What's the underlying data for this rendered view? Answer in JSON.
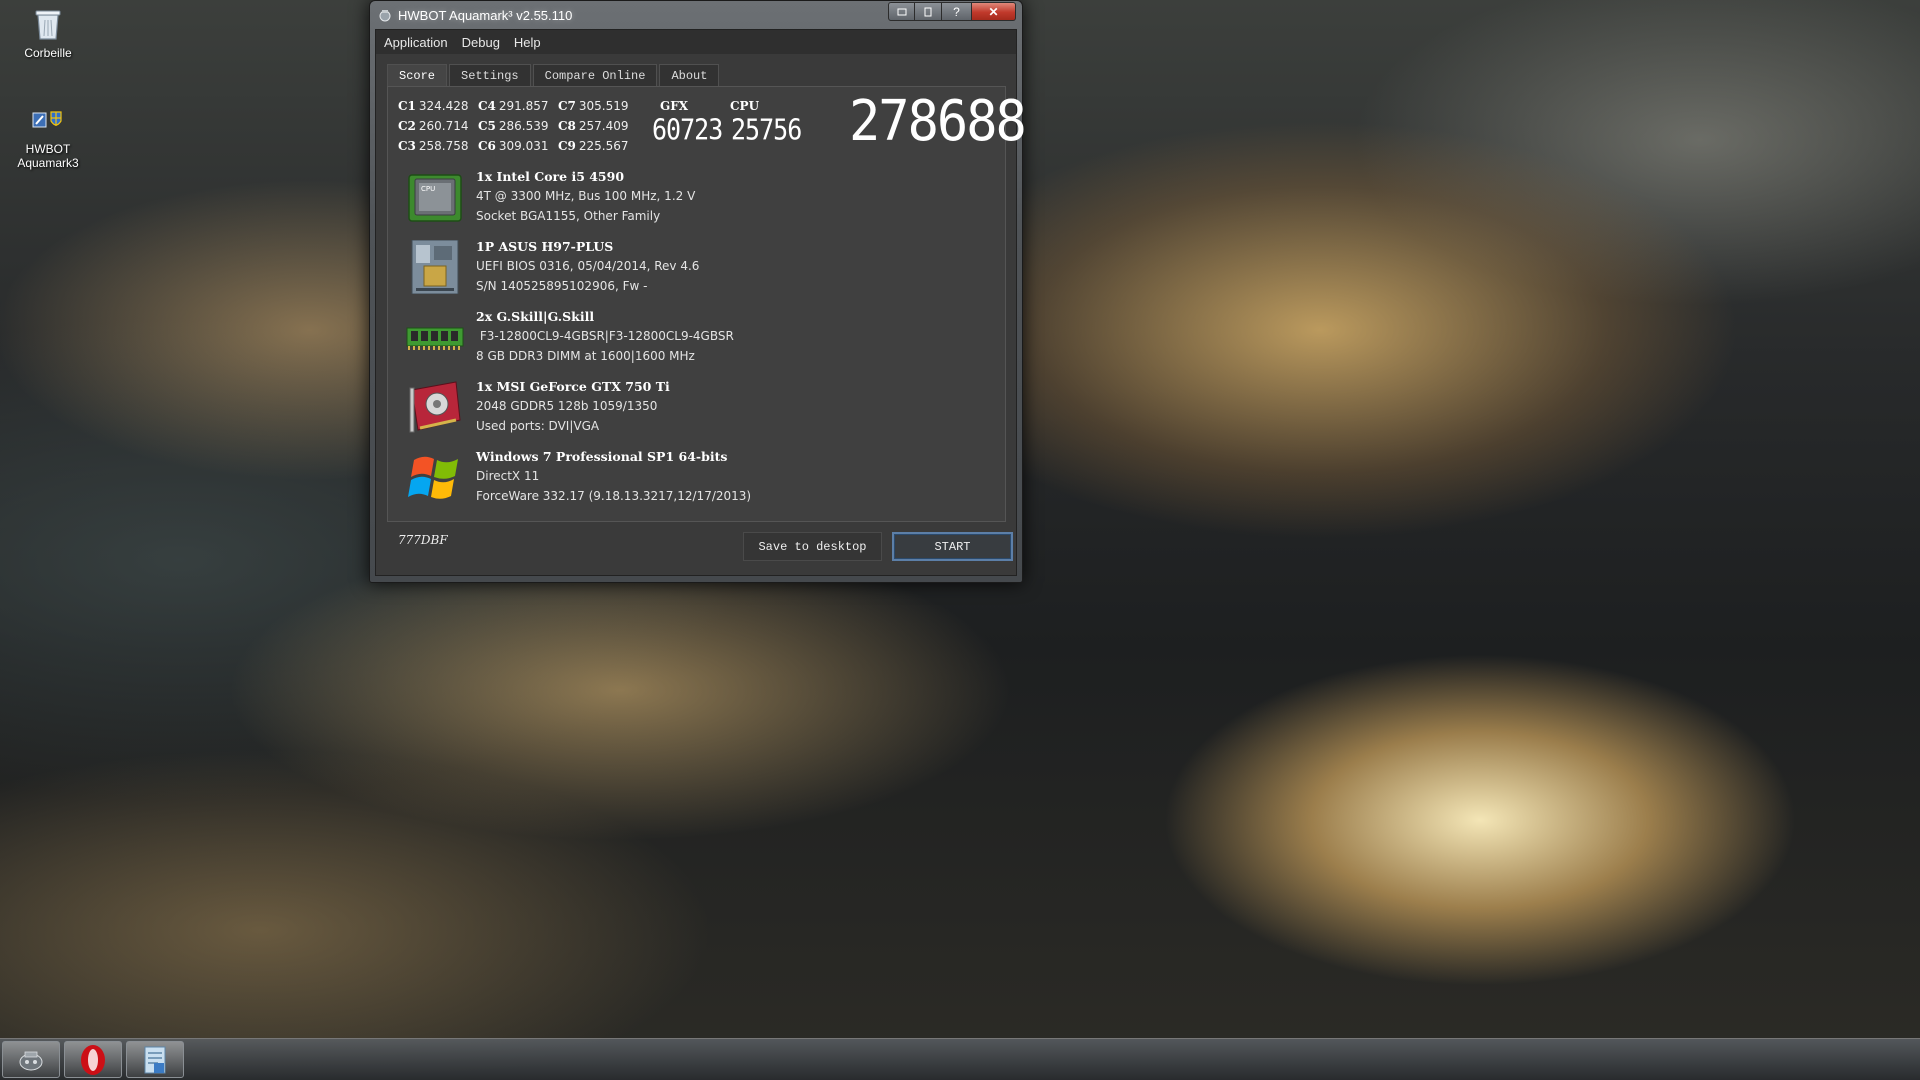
{
  "desktop": {
    "icons": [
      {
        "label": "Corbeille",
        "icon": "recycle-bin-icon"
      },
      {
        "label": "HWBOT\nAquamark3",
        "icon": "aquamark-shortcut-icon"
      }
    ]
  },
  "window": {
    "title": "HWBOT Aquamark³ v2.55.110",
    "caption": {
      "help": "?",
      "close": "✕"
    },
    "menu": [
      "Application",
      "Debug",
      "Help"
    ],
    "tabs": [
      "Score",
      "Settings",
      "Compare Online",
      "About"
    ],
    "active_tab": "Score",
    "scores": [
      {
        "label": "C1",
        "value": "324.428"
      },
      {
        "label": "C4",
        "value": "291.857"
      },
      {
        "label": "C7",
        "value": "305.519"
      },
      {
        "label": "C2",
        "value": "260.714"
      },
      {
        "label": "C5",
        "value": "286.539"
      },
      {
        "label": "C8",
        "value": "257.409"
      },
      {
        "label": "C3",
        "value": "258.758"
      },
      {
        "label": "C6",
        "value": "309.031"
      },
      {
        "label": "C9",
        "value": "225.567"
      }
    ],
    "gfx": {
      "label": "GFX",
      "value": "60723"
    },
    "cpu": {
      "label": "CPU",
      "value": "25756"
    },
    "total_score": "278688",
    "hardware": [
      {
        "icon": "cpu-chip-icon",
        "title": "1x Intel Core i5 4590",
        "lines": [
          "4T @ 3300 MHz, Bus 100 MHz, 1.2 V",
          "Socket BGA1155, Other Family"
        ]
      },
      {
        "icon": "motherboard-icon",
        "title": "1P ASUS H97-PLUS",
        "lines": [
          "UEFI BIOS 0316, 05/04/2014, Rev 4.6",
          "S/N 140525895102906, Fw -"
        ]
      },
      {
        "icon": "memory-module-icon",
        "title": "2x G.Skill|G.Skill",
        "lines": [
          " F3-12800CL9-4GBSR|F3-12800CL9-4GBSR",
          "8 GB DDR3 DIMM at 1600|1600 MHz"
        ]
      },
      {
        "icon": "graphics-card-icon",
        "title": "1x MSI GeForce GTX 750 Ti",
        "lines": [
          "2048 GDDR5 128b 1059/1350",
          "Used ports: DVI|VGA"
        ]
      },
      {
        "icon": "windows-logo-icon",
        "title": "Windows 7 Professional SP1 64-bits",
        "lines": [
          "DirectX 11",
          "ForceWare 332.17 (9.18.13.3217,12/17/2013)"
        ]
      }
    ],
    "code": "777DBF",
    "buttons": {
      "save": "Save to desktop",
      "start": "START"
    }
  },
  "taskbar": {
    "items": [
      {
        "icon": "aquamark-app-icon"
      },
      {
        "icon": "opera-browser-icon"
      },
      {
        "icon": "window-app-icon"
      }
    ]
  },
  "colors": {
    "accent_start_border": "#5c7fa8",
    "close_button": "#c0392b",
    "opera_red": "#cc0f16"
  }
}
